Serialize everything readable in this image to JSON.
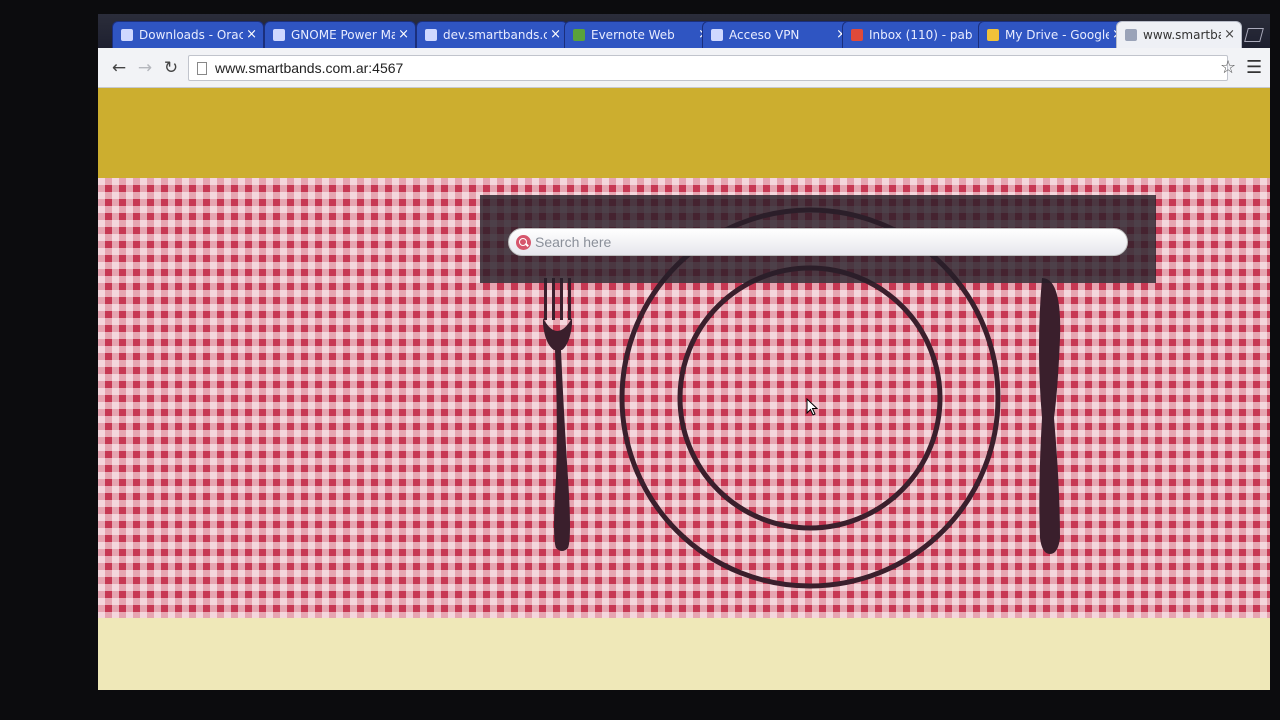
{
  "browser": {
    "tabs": [
      {
        "title": "Downloads - Oracle",
        "active": false
      },
      {
        "title": "GNOME Power Manager",
        "active": false
      },
      {
        "title": "dev.smartbands.com",
        "active": false
      },
      {
        "title": "Evernote Web",
        "active": false
      },
      {
        "title": "Acceso VPN",
        "active": false
      },
      {
        "title": "Inbox (110) - pab",
        "active": false
      },
      {
        "title": "My Drive - Google",
        "active": false
      },
      {
        "title": "www.smartbands.com",
        "active": true
      }
    ],
    "close_glyph": "×",
    "url": "www.smartbands.com.ar:4567",
    "icons": {
      "back": "back-arrow-icon",
      "forward": "forward-arrow-icon",
      "reload": "reload-icon",
      "bookmark": "star-icon",
      "menu": "hamburger-menu-icon"
    }
  },
  "page": {
    "search": {
      "placeholder": "Search here",
      "value": ""
    },
    "colors": {
      "header_band": "#ccae2f",
      "tablecloth_red": "#c73853",
      "footer_band": "#efe8b8",
      "cutlery": "#3a1f2c"
    }
  }
}
